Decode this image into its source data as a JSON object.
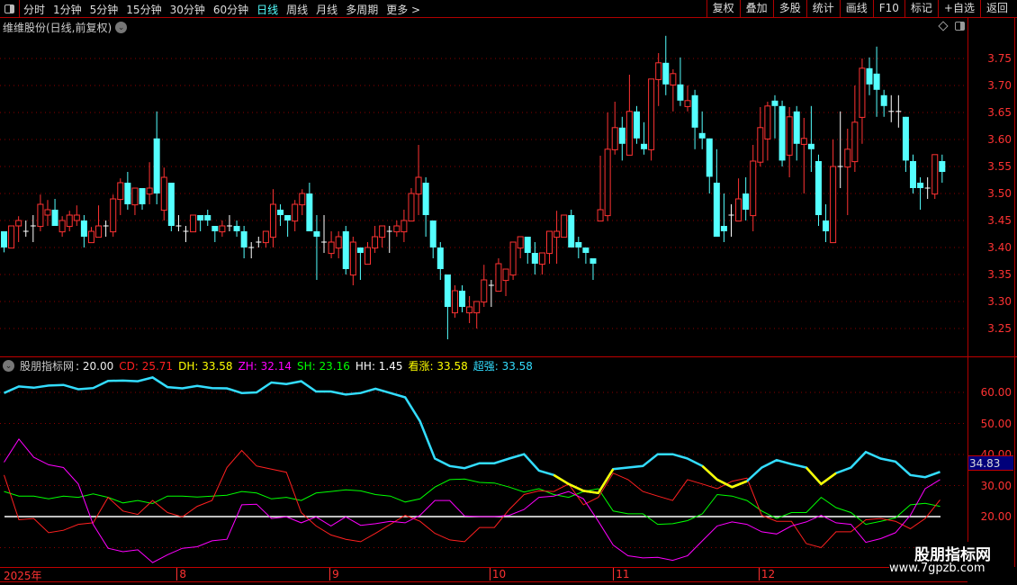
{
  "toolbar": {
    "tabs": [
      "分时",
      "1分钟",
      "5分钟",
      "15分钟",
      "30分钟",
      "60分钟",
      "日线",
      "周线",
      "月线",
      "多周期",
      "更多 >"
    ],
    "active_tab": "日线",
    "buttons": [
      "复权",
      "叠加",
      "多股",
      "统计",
      "画线",
      "F10",
      "标记",
      "+自选",
      "返回"
    ]
  },
  "title": "维维股份(日线,前复权)",
  "indicator_header": {
    "name": "股朋指标网",
    "hh_line": ": 20.00",
    "items": [
      {
        "label": "CD: 25.71",
        "color": "#ff2020"
      },
      {
        "label": "DH: 33.58",
        "color": "#ffff00"
      },
      {
        "label": "ZH: 32.14",
        "color": "#ff00ff"
      },
      {
        "label": "SH: 23.16",
        "color": "#00ff00"
      },
      {
        "label": "HH: 1.45",
        "color": "#ffffff"
      },
      {
        "label": "看涨: 33.58",
        "color": "#ffff00"
      },
      {
        "label": "超强: 33.58",
        "color": "#33ddff"
      }
    ]
  },
  "current_value": "34.83",
  "watermark": {
    "name": "股朋指标网",
    "url": "www.7gpzb.com"
  },
  "colors": {
    "up": "#ff3232",
    "down": "#54ffff",
    "doji": "#ffffff",
    "grid": "#8b0000"
  },
  "chart_data": [
    {
      "type": "candlestick",
      "price_ticks": [
        "3.75",
        "3.70",
        "3.65",
        "3.60",
        "3.55",
        "3.50",
        "3.45",
        "3.40",
        "3.35",
        "3.30",
        "3.25"
      ],
      "ylim": [
        3.2,
        3.8
      ],
      "date_labels": [
        {
          "label": "2025年",
          "index": 0
        },
        {
          "label": "8",
          "index": 24
        },
        {
          "label": "9",
          "index": 45
        },
        {
          "label": "10",
          "index": 67
        },
        {
          "label": "11",
          "index": 84
        },
        {
          "label": "12",
          "index": 104
        }
      ],
      "candles": [
        [
          3.43,
          3.43,
          3.391,
          3.4
        ],
        [
          3.399,
          3.44,
          3.399,
          3.44
        ],
        [
          3.44,
          3.458,
          3.41,
          3.45
        ],
        [
          3.43,
          3.45,
          3.42,
          3.43
        ],
        [
          3.44,
          3.46,
          3.41,
          3.44
        ],
        [
          3.439,
          3.498,
          3.43,
          3.48
        ],
        [
          3.46,
          3.488,
          3.44,
          3.47
        ],
        [
          3.47,
          3.49,
          3.44,
          3.44
        ],
        [
          3.429,
          3.458,
          3.42,
          3.45
        ],
        [
          3.439,
          3.468,
          3.43,
          3.46
        ],
        [
          3.45,
          3.478,
          3.44,
          3.46
        ],
        [
          3.45,
          3.46,
          3.4,
          3.42
        ],
        [
          3.409,
          3.438,
          3.409,
          3.43
        ],
        [
          3.419,
          3.478,
          3.419,
          3.44
        ],
        [
          3.44,
          3.45,
          3.42,
          3.44
        ],
        [
          3.429,
          3.498,
          3.42,
          3.49
        ],
        [
          3.489,
          3.528,
          3.46,
          3.52
        ],
        [
          3.52,
          3.54,
          3.47,
          3.48
        ],
        [
          3.479,
          3.51,
          3.46,
          3.51
        ],
        [
          3.51,
          3.51,
          3.47,
          3.48
        ],
        [
          3.499,
          3.558,
          3.48,
          3.51
        ],
        [
          3.602,
          3.652,
          3.48,
          3.5
        ],
        [
          3.469,
          3.548,
          3.45,
          3.53
        ],
        [
          3.52,
          3.52,
          3.43,
          3.44
        ],
        [
          3.44,
          3.46,
          3.43,
          3.44
        ],
        [
          3.43,
          3.44,
          3.41,
          3.43
        ],
        [
          3.429,
          3.46,
          3.429,
          3.46
        ],
        [
          3.46,
          3.46,
          3.43,
          3.45
        ],
        [
          3.46,
          3.47,
          3.44,
          3.45
        ],
        [
          3.44,
          3.44,
          3.41,
          3.43
        ],
        [
          3.429,
          3.45,
          3.42,
          3.44
        ],
        [
          3.44,
          3.46,
          3.43,
          3.44
        ],
        [
          3.44,
          3.45,
          3.42,
          3.43
        ],
        [
          3.43,
          3.44,
          3.38,
          3.4
        ],
        [
          3.4,
          3.41,
          3.38,
          3.4
        ],
        [
          3.41,
          3.42,
          3.4,
          3.41
        ],
        [
          3.409,
          3.43,
          3.4,
          3.43
        ],
        [
          3.419,
          3.508,
          3.4,
          3.48
        ],
        [
          3.47,
          3.48,
          3.44,
          3.46
        ],
        [
          3.46,
          3.46,
          3.42,
          3.45
        ],
        [
          3.449,
          3.488,
          3.43,
          3.48
        ],
        [
          3.479,
          3.508,
          3.46,
          3.5
        ],
        [
          3.5,
          3.52,
          3.43,
          3.43
        ],
        [
          3.43,
          3.46,
          3.34,
          3.42
        ],
        [
          3.41,
          3.46,
          3.39,
          3.41
        ],
        [
          3.389,
          3.43,
          3.38,
          3.41
        ],
        [
          3.399,
          3.43,
          3.38,
          3.42
        ],
        [
          3.43,
          3.44,
          3.35,
          3.36
        ],
        [
          3.349,
          3.42,
          3.33,
          3.41
        ],
        [
          3.4,
          3.4,
          3.34,
          3.39
        ],
        [
          3.369,
          3.41,
          3.369,
          3.4
        ],
        [
          3.399,
          3.44,
          3.39,
          3.42
        ],
        [
          3.419,
          3.44,
          3.4,
          3.44
        ],
        [
          3.43,
          3.44,
          3.39,
          3.43
        ],
        [
          3.429,
          3.45,
          3.42,
          3.44
        ],
        [
          3.429,
          3.47,
          3.41,
          3.45
        ],
        [
          3.449,
          3.51,
          3.449,
          3.5
        ],
        [
          3.499,
          3.59,
          3.46,
          3.53
        ],
        [
          3.52,
          3.53,
          3.42,
          3.46
        ],
        [
          3.45,
          3.45,
          3.38,
          3.4
        ],
        [
          3.4,
          3.41,
          3.34,
          3.36
        ],
        [
          3.35,
          3.35,
          3.23,
          3.29
        ],
        [
          3.279,
          3.33,
          3.27,
          3.32
        ],
        [
          3.32,
          3.33,
          3.28,
          3.29
        ],
        [
          3.279,
          3.31,
          3.26,
          3.29
        ],
        [
          3.279,
          3.3,
          3.25,
          3.3
        ],
        [
          3.299,
          3.368,
          3.29,
          3.34
        ],
        [
          3.33,
          3.34,
          3.29,
          3.33
        ],
        [
          3.319,
          3.38,
          3.319,
          3.37
        ],
        [
          3.339,
          3.36,
          3.31,
          3.36
        ],
        [
          3.349,
          3.41,
          3.34,
          3.41
        ],
        [
          3.399,
          3.42,
          3.38,
          3.42
        ],
        [
          3.42,
          3.42,
          3.37,
          3.39
        ],
        [
          3.39,
          3.41,
          3.35,
          3.37
        ],
        [
          3.369,
          3.39,
          3.35,
          3.39
        ],
        [
          3.389,
          3.43,
          3.37,
          3.43
        ],
        [
          3.419,
          3.468,
          3.37,
          3.43
        ],
        [
          3.419,
          3.46,
          3.419,
          3.46
        ],
        [
          3.46,
          3.47,
          3.4,
          3.4
        ],
        [
          3.41,
          3.42,
          3.38,
          3.4
        ],
        [
          3.4,
          3.4,
          3.37,
          3.39
        ],
        [
          3.38,
          3.38,
          3.34,
          3.37
        ],
        [
          3.449,
          3.57,
          3.449,
          3.47
        ],
        [
          3.459,
          3.65,
          3.449,
          3.582
        ],
        [
          3.581,
          3.67,
          3.572,
          3.622
        ],
        [
          3.622,
          3.642,
          3.561,
          3.592
        ],
        [
          3.571,
          3.72,
          3.571,
          3.652
        ],
        [
          3.652,
          3.662,
          3.592,
          3.602
        ],
        [
          3.592,
          3.632,
          3.572,
          3.582
        ],
        [
          3.581,
          3.712,
          3.561,
          3.712
        ],
        [
          3.711,
          3.76,
          3.662,
          3.742
        ],
        [
          3.742,
          3.792,
          3.682,
          3.702
        ],
        [
          3.701,
          3.73,
          3.652,
          3.722
        ],
        [
          3.702,
          3.752,
          3.662,
          3.672
        ],
        [
          3.661,
          3.7,
          3.652,
          3.672
        ],
        [
          3.682,
          3.692,
          3.582,
          3.622
        ],
        [
          3.612,
          3.652,
          3.582,
          3.602
        ],
        [
          3.602,
          3.602,
          3.5,
          3.531
        ],
        [
          3.52,
          3.582,
          3.42,
          3.42
        ],
        [
          3.44,
          3.5,
          3.41,
          3.43
        ],
        [
          3.46,
          3.48,
          3.42,
          3.46
        ],
        [
          3.449,
          3.528,
          3.449,
          3.49
        ],
        [
          3.5,
          3.53,
          3.45,
          3.47
        ],
        [
          3.459,
          3.59,
          3.43,
          3.56
        ],
        [
          3.558,
          3.66,
          3.55,
          3.622
        ],
        [
          3.601,
          3.67,
          3.561,
          3.662
        ],
        [
          3.672,
          3.682,
          3.602,
          3.662
        ],
        [
          3.662,
          3.672,
          3.55,
          3.561
        ],
        [
          3.571,
          3.66,
          3.53,
          3.642
        ],
        [
          3.652,
          3.662,
          3.561,
          3.592
        ],
        [
          3.591,
          3.64,
          3.5,
          3.602
        ],
        [
          3.592,
          3.662,
          3.54,
          3.582
        ],
        [
          3.56,
          3.572,
          3.44,
          3.46
        ],
        [
          3.45,
          3.48,
          3.41,
          3.43
        ],
        [
          3.409,
          3.6,
          3.409,
          3.55
        ],
        [
          3.55,
          3.652,
          3.51,
          3.55
        ],
        [
          3.549,
          3.62,
          3.46,
          3.582
        ],
        [
          3.559,
          3.7,
          3.54,
          3.632
        ],
        [
          3.641,
          3.75,
          3.592,
          3.732
        ],
        [
          3.732,
          3.752,
          3.682,
          3.702
        ],
        [
          3.722,
          3.772,
          3.642,
          3.692
        ],
        [
          3.682,
          3.692,
          3.642,
          3.662
        ],
        [
          3.652,
          3.682,
          3.632,
          3.652
        ],
        [
          3.652,
          3.682,
          3.622,
          3.652
        ],
        [
          3.642,
          3.642,
          3.54,
          3.561
        ],
        [
          3.56,
          3.572,
          3.5,
          3.51
        ],
        [
          3.52,
          3.53,
          3.47,
          3.51
        ],
        [
          3.51,
          3.53,
          3.49,
          3.51
        ],
        [
          3.499,
          3.572,
          3.49,
          3.572
        ],
        [
          3.56,
          3.572,
          3.52,
          3.54
        ]
      ]
    },
    {
      "type": "line",
      "title": "股朋指标网",
      "ticks": [
        "60.00",
        "50.00",
        "40.00",
        "30.00",
        "20.00"
      ],
      "ylim": [
        5,
        68
      ],
      "hh_level": 20,
      "x_note": "64 evenly spaced samples across the candle range",
      "series": [
        {
          "name": "超强",
          "color": "#33ddff",
          "values": [
            59.8,
            61.9,
            61.5,
            62.2,
            62.4,
            61,
            61.4,
            63.7,
            63.8,
            63.6,
            64.8,
            61.7,
            61.3,
            62.1,
            61.4,
            61.3,
            59.8,
            60,
            63.2,
            62.7,
            63.6,
            60.3,
            60.3,
            59.3,
            59.8,
            61.2,
            59.8,
            58.4,
            50.7,
            38.7,
            36.3,
            35.6,
            37.2,
            37.2,
            38.7,
            40.1,
            34.8,
            33.4,
            30.5,
            28.3,
            27.6,
            35.3,
            35.8,
            36.3,
            40.1,
            40.1,
            38.7,
            36.3,
            31.9,
            29.5,
            31.4,
            35.8,
            38.2,
            36.9,
            35.8,
            30.5,
            34,
            35.8,
            40.8,
            38.7,
            37.7,
            33.4,
            32.7,
            34.4
          ],
          "highlight_color": "#ffff00",
          "highlight_ranges": [
            [
              37,
              41
            ],
            [
              47,
              50
            ],
            [
              54,
              56
            ]
          ]
        },
        {
          "name": "CD",
          "color": "#ff2020",
          "values": [
            33.4,
            19,
            19.4,
            14.8,
            15.6,
            17.5,
            18,
            26.2,
            21.8,
            20.7,
            25.2,
            21.3,
            19.9,
            23.3,
            25.2,
            35.8,
            41.3,
            36.3,
            35.3,
            34.3,
            21.3,
            17,
            14.1,
            12.7,
            11.9,
            14.6,
            17.5,
            20.4,
            18.5,
            14.6,
            12.5,
            11.9,
            16.5,
            16.5,
            22.3,
            27.1,
            28.3,
            28.1,
            30.5,
            23.8,
            26.2,
            34,
            31.9,
            28.1,
            26.6,
            25.2,
            31.9,
            30.5,
            29,
            31.4,
            32.4,
            20.4,
            18.5,
            18.5,
            11.3,
            10,
            15.1,
            15.1,
            19,
            19.4,
            18.5,
            16.1,
            19.4,
            25.4
          ]
        },
        {
          "name": "ZH",
          "color": "#ff00ff",
          "values": [
            37.5,
            45,
            39.1,
            36.7,
            35.8,
            30.5,
            17.5,
            9.8,
            8.7,
            9.3,
            5.2,
            7.7,
            9.8,
            10.3,
            12.2,
            12.7,
            23.8,
            24,
            19.4,
            19.9,
            18,
            19.9,
            17,
            19.9,
            17.2,
            17.7,
            18.5,
            18,
            20.4,
            25.2,
            25.2,
            20.2,
            20,
            20,
            20.4,
            22.3,
            26.2,
            26.6,
            28.1,
            25.7,
            18.5,
            10.8,
            7.4,
            6.7,
            6.9,
            5.9,
            7.4,
            12.2,
            17,
            18.3,
            17.5,
            15.1,
            14.4,
            17,
            18.3,
            20.4,
            18,
            17.5,
            11.7,
            12.9,
            14.8,
            20.4,
            29,
            31.9
          ]
        },
        {
          "name": "SH",
          "color": "#00ff00",
          "values": [
            28.1,
            26.6,
            26.6,
            25.7,
            26.6,
            26.2,
            27.3,
            26.2,
            24.4,
            25.2,
            24.2,
            26.6,
            26.6,
            26.3,
            26.6,
            26.9,
            28.1,
            27.6,
            25.7,
            26.2,
            25.2,
            27.6,
            28.1,
            28.6,
            28.3,
            27.1,
            26.6,
            24.7,
            25.7,
            29.5,
            31.9,
            32.1,
            31,
            30.8,
            29.5,
            27.9,
            29,
            27.1,
            26.2,
            28.1,
            29,
            21.8,
            20.9,
            20.9,
            17.5,
            17.7,
            18.7,
            20.9,
            27.1,
            26.6,
            25.2,
            21.8,
            19.4,
            21.3,
            21.3,
            26.2,
            22.9,
            21.3,
            17.5,
            18.5,
            19.6,
            23.8,
            24.3,
            23.3
          ]
        }
      ]
    }
  ]
}
